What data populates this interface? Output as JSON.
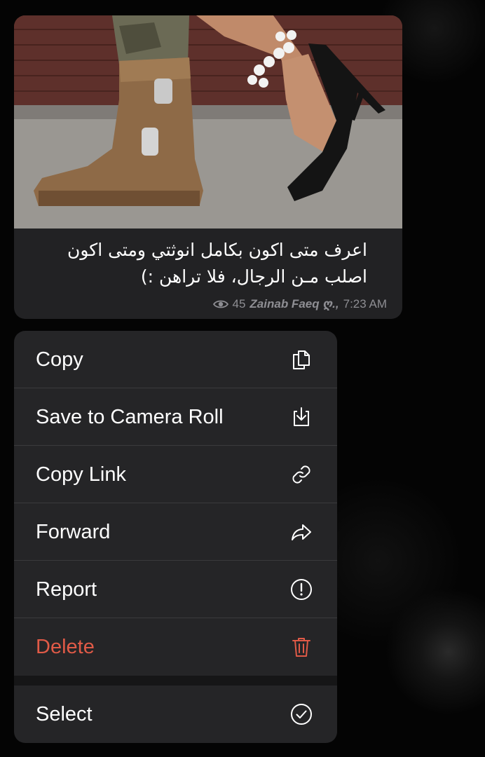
{
  "message": {
    "caption": "اعرف متى اكون بكامل انوثتي ومتى اكون اصلب مـن الرجال، فلا تراهن :)",
    "views": "45",
    "author": "Zainab Faeq ღ.,",
    "time": "7:23 AM",
    "image_icon": "photo-military-boot-and-high-heel"
  },
  "menu": {
    "items": [
      {
        "label": "Copy",
        "icon": "copy-icon"
      },
      {
        "label": "Save to Camera Roll",
        "icon": "save-download-icon"
      },
      {
        "label": "Copy Link",
        "icon": "link-icon"
      },
      {
        "label": "Forward",
        "icon": "forward-arrow-icon"
      },
      {
        "label": "Report",
        "icon": "exclamation-circle-icon"
      },
      {
        "label": "Delete",
        "icon": "trash-icon"
      },
      {
        "label": "Select",
        "icon": "checkmark-circle-icon"
      }
    ],
    "delete_color": "#e05a47",
    "background": "#252527"
  }
}
